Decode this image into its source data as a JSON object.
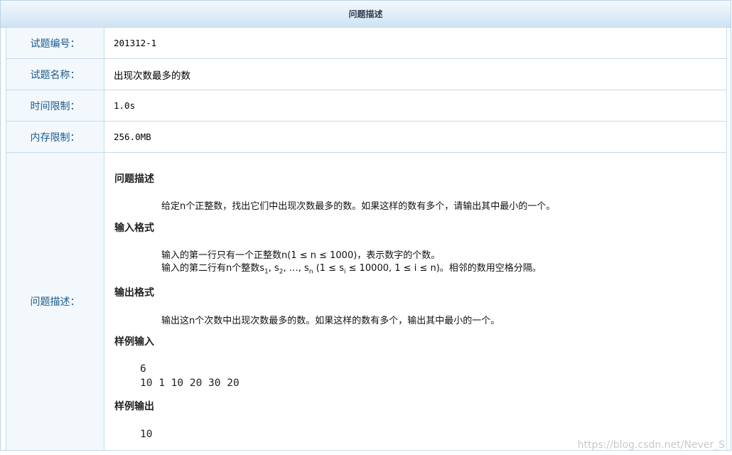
{
  "panel": {
    "title": "问题描述"
  },
  "rows": {
    "id": {
      "label": "试题编号：",
      "value": "201312-1"
    },
    "name": {
      "label": "试题名称：",
      "value": "出现次数最多的数"
    },
    "time": {
      "label": "时间限制：",
      "value": "1.0s"
    },
    "memory": {
      "label": "内存限制：",
      "value": "256.0MB"
    },
    "description": {
      "label": "问题描述："
    }
  },
  "problem": {
    "heading_desc": "问题描述",
    "desc_text": "给定n个正整数，找出它们中出现次数最多的数。如果这样的数有多个，请输出其中最小的一个。",
    "heading_input": "输入格式",
    "input_line1": "输入的第一行只有一个正整数n(1 ≤ n ≤ 1000)，表示数字的个数。",
    "input_line2_a": "输入的第二行有n个整数s",
    "input_line2_sub1": "1",
    "input_line2_b": ", s",
    "input_line2_sub2": "2",
    "input_line2_c": ", …, s",
    "input_line2_subn": "n",
    "input_line2_d": " (1 ≤ s",
    "input_line2_subi": "i",
    "input_line2_e": " ≤ 10000, 1 ≤ i ≤ n)。相邻的数用空格分隔。",
    "heading_output": "输出格式",
    "output_text": "输出这n个次数中出现次数最多的数。如果这样的数有多个，输出其中最小的一个。",
    "heading_sample_in": "样例输入",
    "sample_in_line1": "6",
    "sample_in_line2": "10 1 10 20 30 20",
    "heading_sample_out": "样例输出",
    "sample_out_line1": "10"
  },
  "watermark": "https://blog.csdn.net/Never_S"
}
